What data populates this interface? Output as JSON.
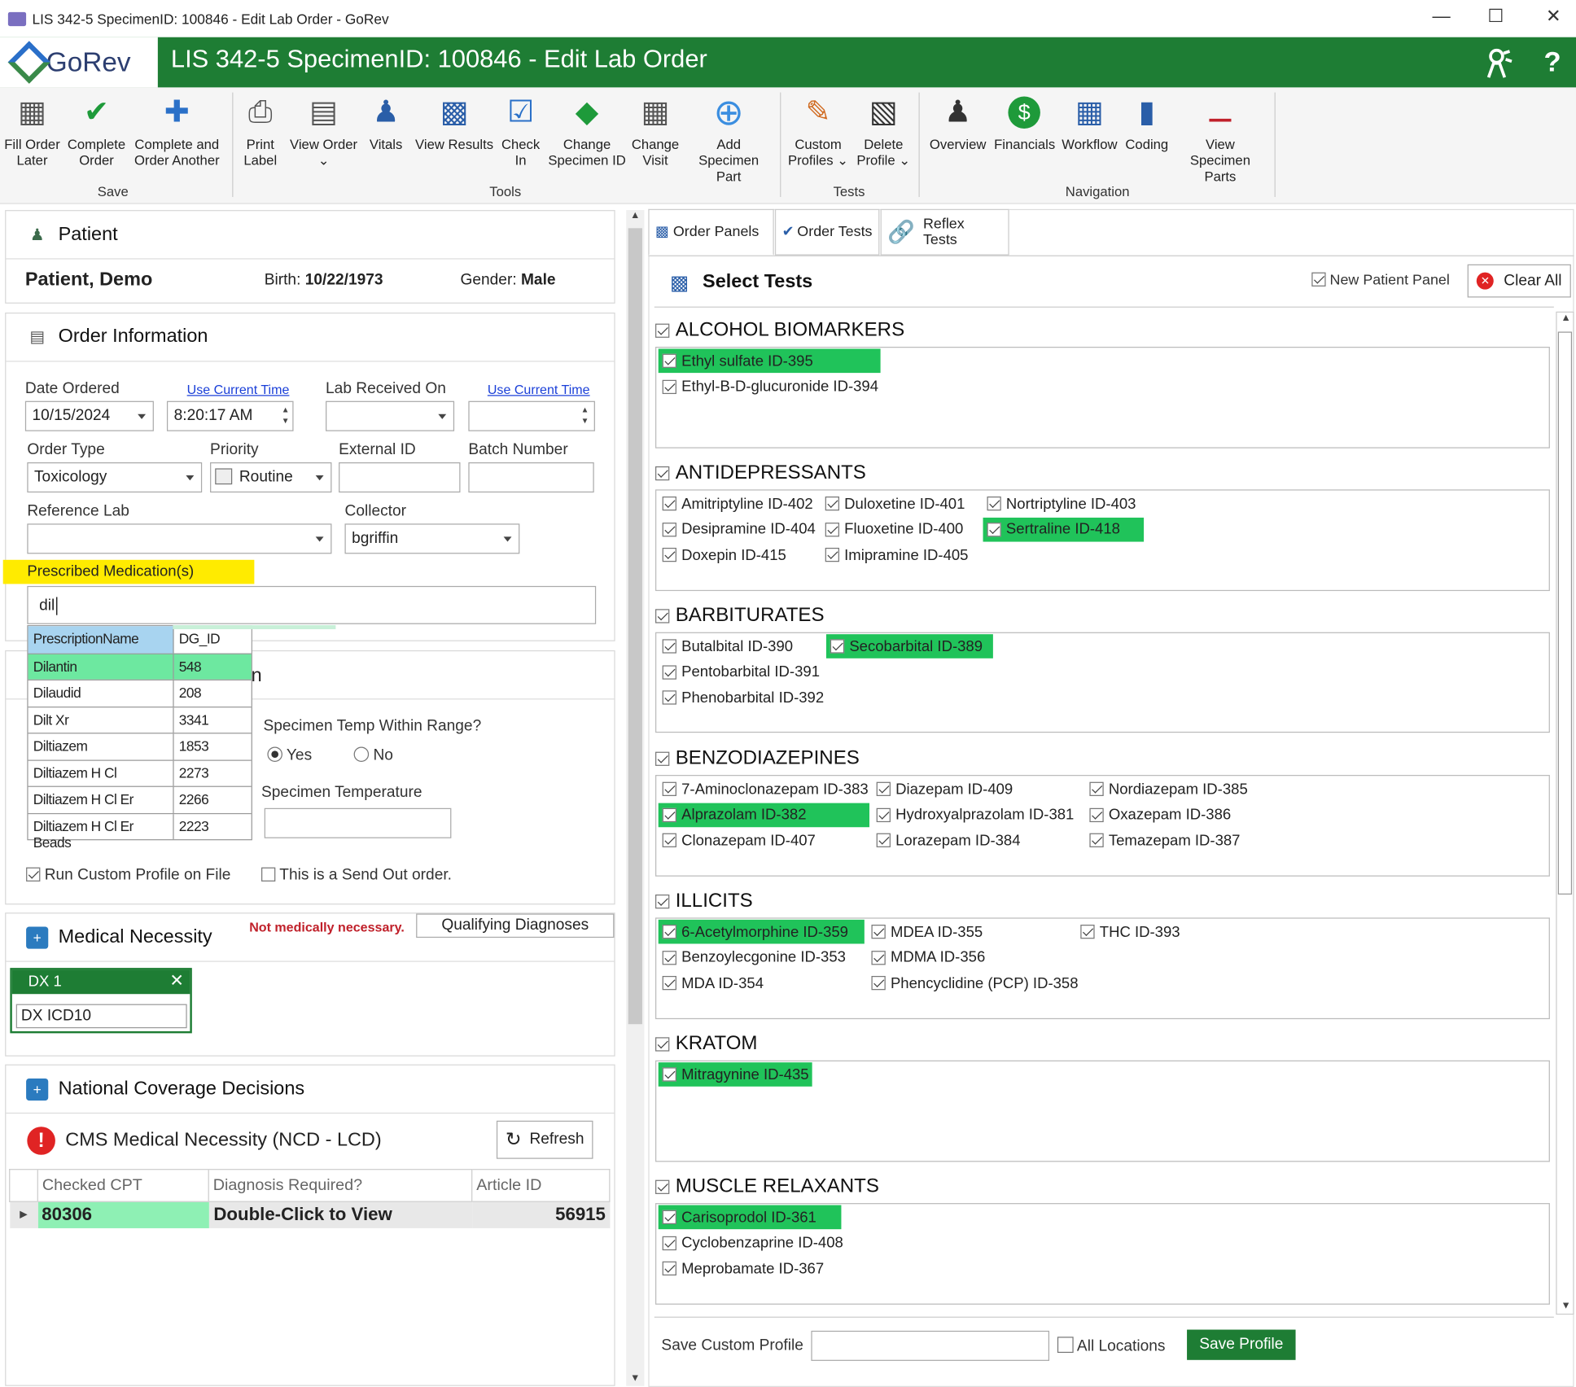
{
  "window": {
    "title": "LIS 342-5 SpecimenID: 100846 - Edit Lab Order - GoRev",
    "minimize": "—",
    "maximize": "☐",
    "close": "✕"
  },
  "header": {
    "logo": "GoRev",
    "title": "LIS 342-5 SpecimenID: 100846 - Edit Lab Order",
    "accent": "#1e7d34"
  },
  "ribbon": {
    "buttons": [
      {
        "l1": "Fill Order",
        "l2": "Later",
        "icon": "calendar-clock-icon"
      },
      {
        "l1": "Complete",
        "l2": "Order",
        "icon": "checkmark-icon"
      },
      {
        "l1": "Complete and",
        "l2": "Order Another",
        "icon": "plus-icon"
      },
      {
        "l1": "Print",
        "l2": "Label",
        "icon": "printer-icon"
      },
      {
        "l1": "View Order",
        "l2": "⌄",
        "icon": "document-search-icon"
      },
      {
        "l1": "Vitals",
        "l2": "",
        "icon": "body-icon"
      },
      {
        "l1": "View Results",
        "l2": "",
        "icon": "test-tubes-icon"
      },
      {
        "l1": "Check",
        "l2": "In",
        "icon": "clipboard-shield-icon"
      },
      {
        "l1": "Change",
        "l2": "Specimen ID",
        "icon": "tag-icon"
      },
      {
        "l1": "Change",
        "l2": "Visit",
        "icon": "calendar-icon"
      },
      {
        "l1": "Add Specimen",
        "l2": "Part",
        "icon": "add-circle-icon"
      },
      {
        "l1": "Custom",
        "l2": "Profiles ⌄",
        "icon": "pencil-icon"
      },
      {
        "l1": "Delete",
        "l2": "Profile ⌄",
        "icon": "delete-document-icon"
      },
      {
        "l1": "Overview",
        "l2": "",
        "icon": "person-icon"
      },
      {
        "l1": "Financials",
        "l2": "",
        "icon": "dollar-icon"
      },
      {
        "l1": "Workflow",
        "l2": "",
        "icon": "workflow-icon"
      },
      {
        "l1": "Coding",
        "l2": "",
        "icon": "book-icon"
      },
      {
        "l1": "View Specimen",
        "l2": "Parts",
        "icon": "specimen-icon"
      }
    ],
    "groups": [
      "Save",
      "Tools",
      "Tests",
      "Navigation"
    ]
  },
  "patient": {
    "section": "Patient",
    "name": "Patient, Demo",
    "birth_label": "Birth:",
    "birth": "10/22/1973",
    "gender_label": "Gender:",
    "gender": "Male"
  },
  "order": {
    "section": "Order Information",
    "date_ordered_label": "Date Ordered",
    "use_current_time": "Use Current Time",
    "date_ordered": "10/15/2024",
    "time_ordered": "8:20:17 AM",
    "lab_received_label": "Lab Received On",
    "order_type_label": "Order Type",
    "order_type": "Toxicology",
    "priority_label": "Priority",
    "priority": "Routine",
    "external_id_label": "External ID",
    "batch_label": "Batch Number",
    "reference_lab_label": "Reference Lab",
    "collector_label": "Collector",
    "collector": "bgriffin",
    "prescribed_label": "Prescribed Medication(s)",
    "prescribed_value": "dil",
    "specimen_temp_q": "Specimen Temp Within Range?",
    "yes": "Yes",
    "no": "No",
    "specimen_temp_label": "Specimen Temperature",
    "run_custom": "Run Custom Profile on File",
    "send_out": "This is a Send Out order."
  },
  "autocomplete": {
    "headers": [
      "PrescriptionName",
      "DG_ID"
    ],
    "rows": [
      [
        "Dilantin",
        "548"
      ],
      [
        "Dilaudid",
        "208"
      ],
      [
        "Dilt Xr",
        "3341"
      ],
      [
        "Diltiazem",
        "1853"
      ],
      [
        "Diltiazem H Cl",
        "2273"
      ],
      [
        "Diltiazem H Cl Er",
        "2266"
      ],
      [
        "Diltiazem H Cl Er Beads",
        "2223"
      ]
    ]
  },
  "medical": {
    "section": "Medical Necessity",
    "not_necessary": "Not medically necessary.",
    "qualifying": "Qualifying Diagnoses",
    "dx_title": "DX 1",
    "dx_close": "✕",
    "dx_value": "DX ICD10"
  },
  "ncd": {
    "section": "National Coverage Decisions",
    "cms": "CMS Medical Necessity (NCD - LCD)",
    "refresh": "Refresh",
    "cols": [
      "Checked CPT",
      "Diagnosis Required?",
      "Article ID"
    ],
    "row": [
      "80306",
      "Double-Click to View",
      "56915"
    ]
  },
  "tabs": [
    "Order Panels",
    "Order Tests",
    "Reflex Tests"
  ],
  "select": {
    "title": "Select Tests",
    "new_patient_panel": "New Patient Panel",
    "clear_all": "Clear All"
  },
  "groups": [
    {
      "name": "ALCOHOL BIOMARKERS",
      "tests": [
        "Ethyl sulfate ID-395",
        "Ethyl-B-D-glucuronide ID-394"
      ]
    },
    {
      "name": "ANTIDEPRESSANTS",
      "tests": [
        "Amitriptyline ID-402",
        "Desipramine ID-404",
        "Doxepin ID-415",
        "Duloxetine ID-401",
        "Fluoxetine ID-400",
        "Imipramine ID-405",
        "Nortriptyline ID-403",
        "Sertraline ID-418"
      ]
    },
    {
      "name": "BARBITURATES",
      "tests": [
        "Butalbital ID-390",
        "Pentobarbital ID-391",
        "Phenobarbital ID-392",
        "Secobarbital ID-389"
      ]
    },
    {
      "name": "BENZODIAZEPINES",
      "tests": [
        "7-Aminoclonazepam ID-383",
        "Alprazolam ID-382",
        "Clonazepam ID-407",
        "Diazepam ID-409",
        "Hydroxyalprazolam ID-381",
        "Lorazepam ID-384",
        "Nordiazepam ID-385",
        "Oxazepam ID-386",
        "Temazepam ID-387"
      ]
    },
    {
      "name": "ILLICITS",
      "tests": [
        "6-Acetylmorphine ID-359",
        "Benzoylecgonine ID-353",
        "MDA ID-354",
        "MDEA ID-355",
        "MDMA ID-356",
        "Phencyclidine (PCP) ID-358",
        "THC ID-393"
      ]
    },
    {
      "name": "KRATOM",
      "tests": [
        "Mitragynine ID-435"
      ]
    },
    {
      "name": "MUSCLE RELAXANTS",
      "tests": [
        "Carisoprodol ID-361",
        "Cyclobenzaprine ID-408",
        "Meprobamate ID-367"
      ]
    }
  ],
  "footer": {
    "save_custom": "Save Custom Profile",
    "all_locations": "All Locations",
    "save_profile": "Save Profile"
  }
}
